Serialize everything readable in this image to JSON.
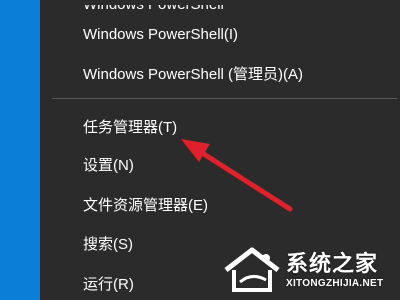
{
  "menu": {
    "items": [
      {
        "label": "Windows PowerShell"
      },
      {
        "label": "Windows PowerShell(I)"
      },
      {
        "label": "Windows PowerShell (管理员)(A)"
      },
      {
        "label": "任务管理器(T)"
      },
      {
        "label": "设置(N)"
      },
      {
        "label": "文件资源管理器(E)"
      },
      {
        "label": "搜索(S)"
      },
      {
        "label": "运行(R)"
      }
    ]
  },
  "annotation": {
    "arrow_color": "#e0202a"
  },
  "watermark": {
    "title": "系统之家",
    "url": "XITONGZHIJIA.NET"
  },
  "colors": {
    "menu_bg": "#2b2b2b",
    "menu_text": "#ffffff",
    "accent_blue": "#0a78d4"
  }
}
